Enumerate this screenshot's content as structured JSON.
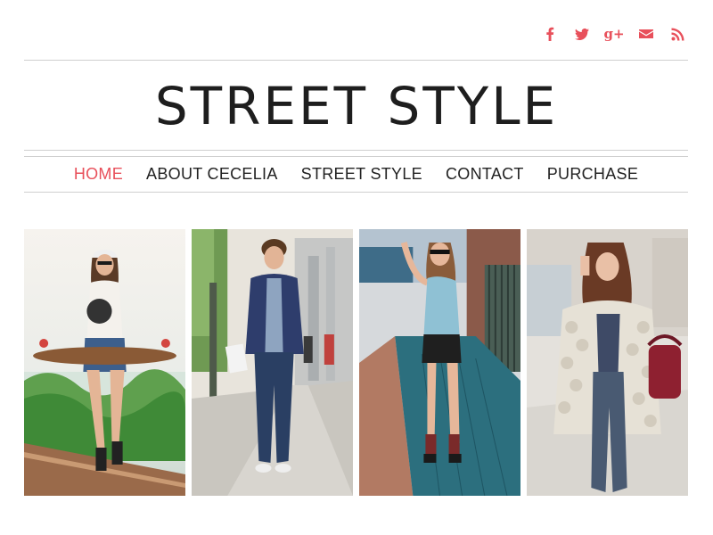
{
  "social": {
    "icons": [
      "facebook-icon",
      "twitter-icon",
      "google-plus-icon",
      "email-icon",
      "rss-icon"
    ],
    "gplus_text": "g+",
    "accent_color": "#e8505b"
  },
  "site": {
    "title": "STREET STYLE"
  },
  "nav": {
    "items": [
      {
        "label": "HOME",
        "active": true
      },
      {
        "label": "ABOUT CECELIA",
        "active": false
      },
      {
        "label": "STREET STYLE",
        "active": false
      },
      {
        "label": "CONTACT",
        "active": false
      },
      {
        "label": "PURCHASE",
        "active": false
      }
    ]
  },
  "gallery": {
    "photos": [
      {
        "subject": "woman-with-skateboard"
      },
      {
        "subject": "man-in-blazer"
      },
      {
        "subject": "woman-in-sunglasses"
      },
      {
        "subject": "woman-in-fur-coat"
      }
    ]
  }
}
